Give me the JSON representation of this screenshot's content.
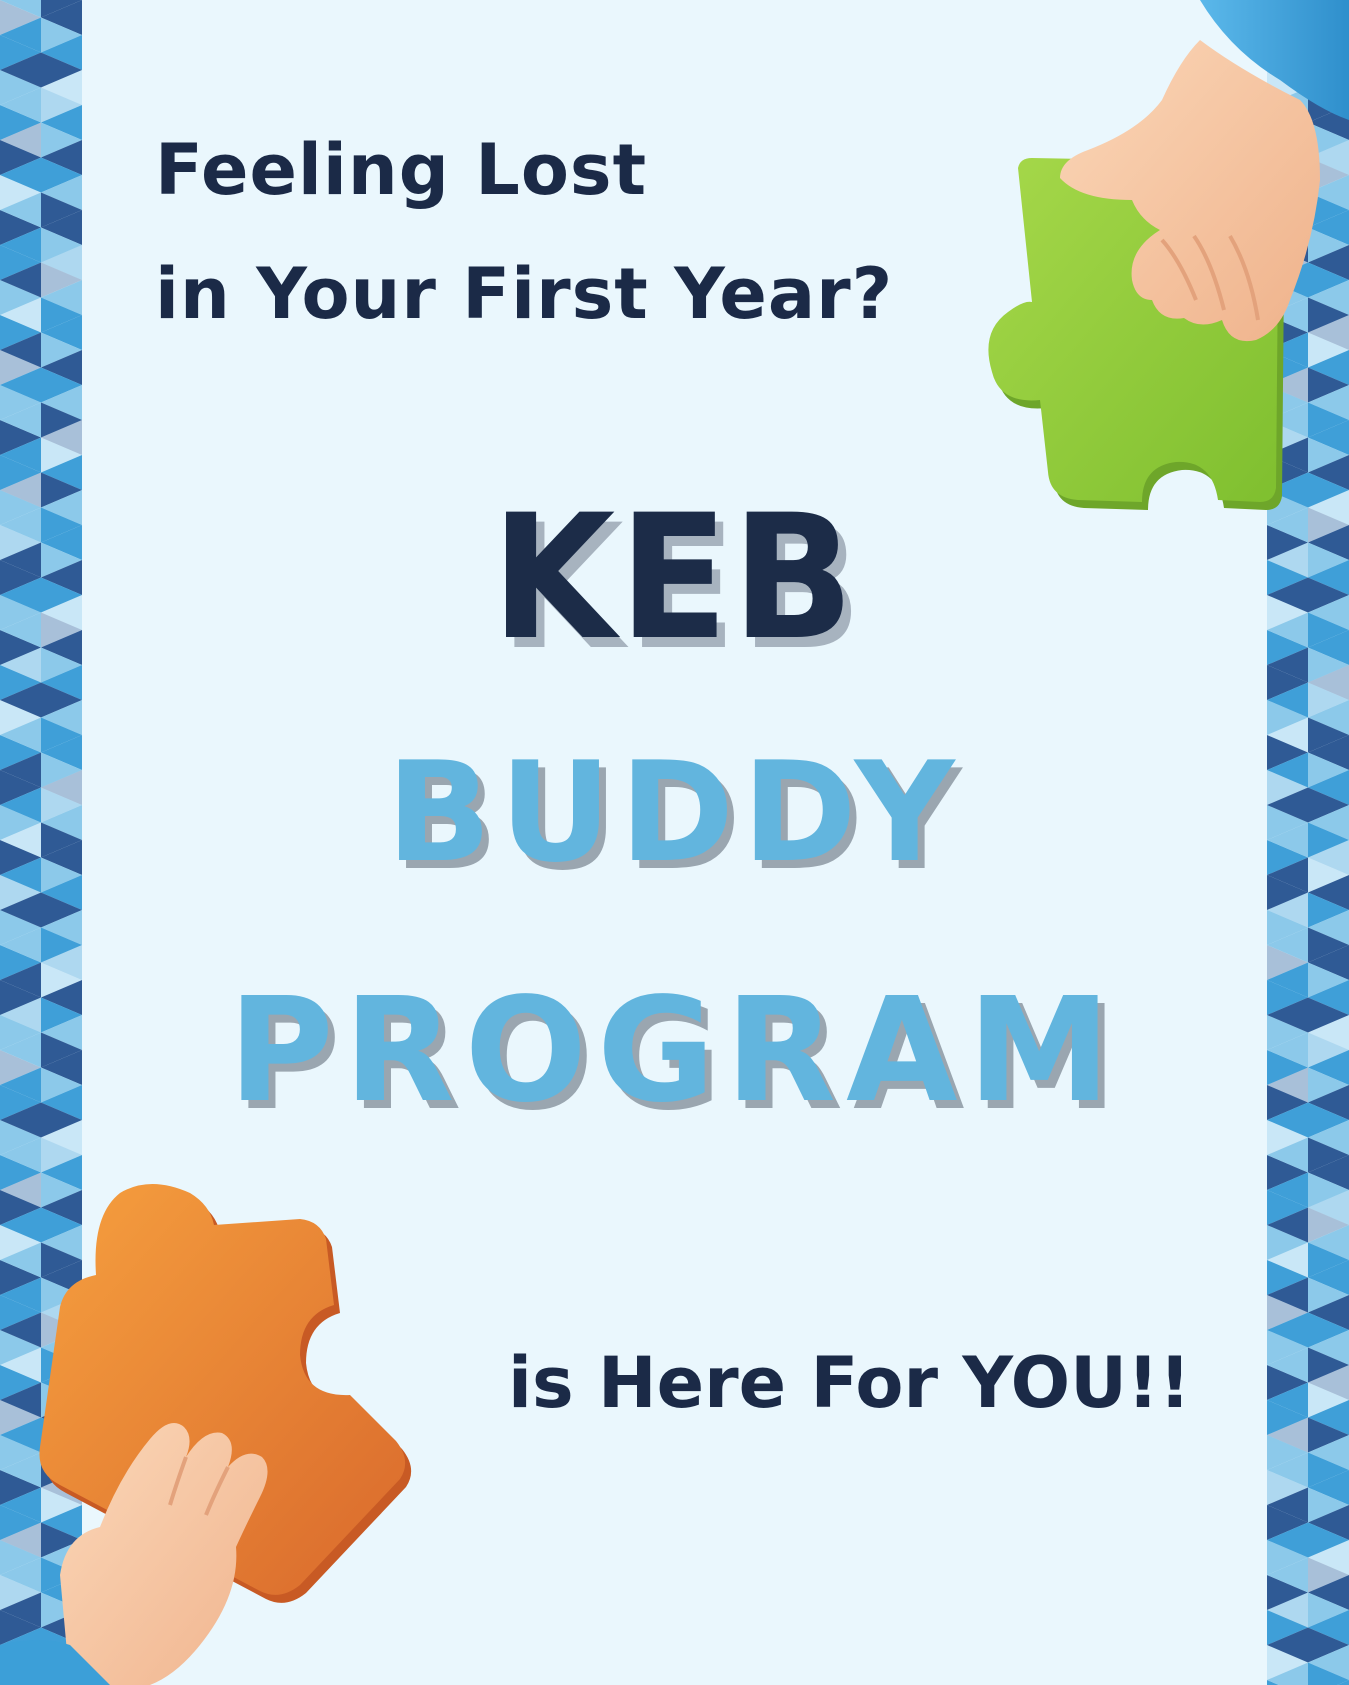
{
  "poster": {
    "headline_line1": "Feeling Lost",
    "headline_line2": "in Your First Year?",
    "title_keb": "KEB",
    "title_buddy": "BUDDY",
    "title_program": "PROGRAM",
    "tagline": "is Here For YOU!!"
  },
  "illustrations": {
    "top_right": "green-puzzle-piece-held-by-hand",
    "bottom_left": "orange-puzzle-piece-held-by-hand"
  },
  "colors": {
    "background": "#eaf7fd",
    "navy_text": "#1b2a47",
    "light_blue_text": "#62b5de",
    "shadow_grey": "#a7b3bf",
    "pattern_dark": "#2f5a95",
    "pattern_mid": "#3f9fd8",
    "pattern_light": "#8cc9ea",
    "green_piece": "#8dc63f",
    "orange_piece": "#ee8a35",
    "skin": "#f6c8a3",
    "sleeve": "#4aa8df"
  }
}
